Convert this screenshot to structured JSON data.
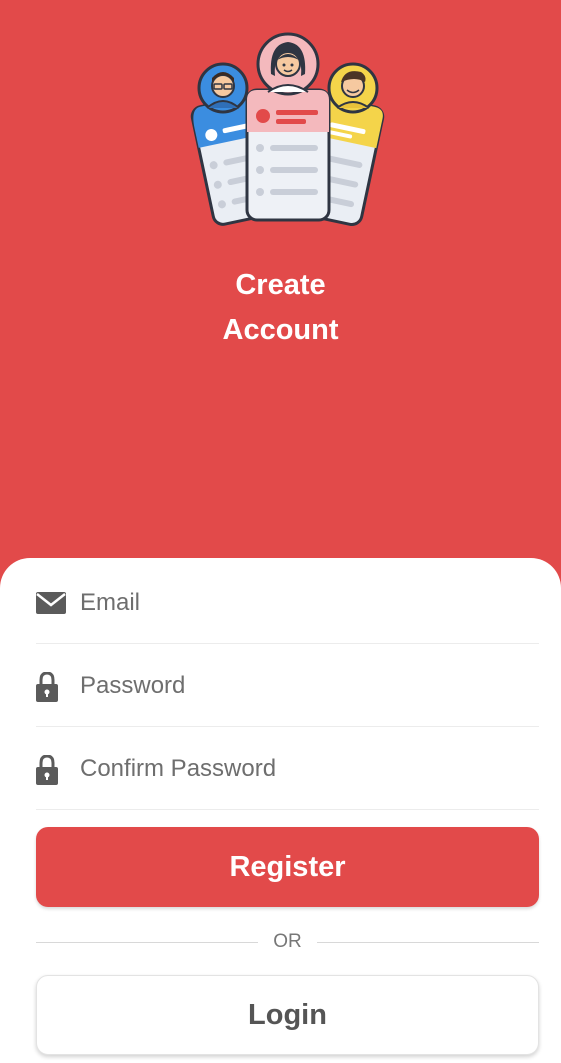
{
  "header": {
    "title_line1": "Create",
    "title_line2": "Account",
    "illustration": "user-profile-cards-illustration"
  },
  "form": {
    "email_placeholder": "Email",
    "password_placeholder": "Password",
    "confirm_password_placeholder": "Confirm Password",
    "email_icon": "envelope-icon",
    "password_icon": "lock-icon",
    "confirm_password_icon": "lock-icon"
  },
  "actions": {
    "register_label": "Register",
    "divider_label": "OR",
    "login_label": "Login"
  },
  "colors": {
    "primary": "#e24a4a",
    "background": "#ffffff",
    "text_muted": "#6e6e6e"
  }
}
